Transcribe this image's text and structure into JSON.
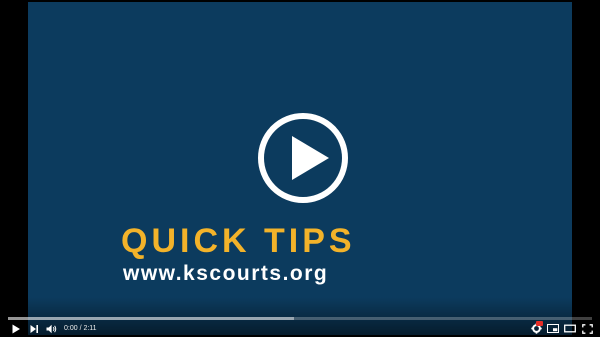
{
  "video": {
    "title_text": "QUICK TIPS",
    "url_text": "www.kscourts.org"
  },
  "player": {
    "current_time": "0:00",
    "separator": " / ",
    "duration": "2:11",
    "loaded_fraction": 0.49
  },
  "icons": {
    "big_play": "play-circle-icon",
    "play": "play-icon",
    "next": "next-icon",
    "volume": "volume-icon",
    "settings": "gear-icon",
    "miniplayer": "miniplayer-icon",
    "theater": "theater-mode-icon",
    "fullscreen": "fullscreen-icon"
  },
  "colors": {
    "background": "#0c3b5e",
    "title": "#f3b32a",
    "url": "#ffffff",
    "hd_badge": "#e52d27"
  }
}
